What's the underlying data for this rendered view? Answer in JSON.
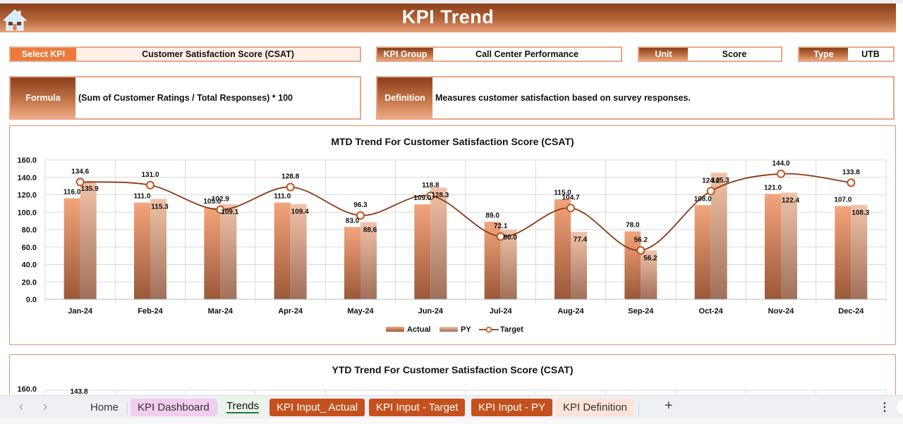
{
  "header": {
    "title": "KPI Trend",
    "home_icon": "home-icon"
  },
  "selectors": {
    "select_kpi": {
      "label": "Select KPI",
      "value": "Customer Satisfaction Score (CSAT)"
    },
    "kpi_group": {
      "label": "KPI Group",
      "value": "Call Center Performance"
    },
    "unit": {
      "label": "Unit",
      "value": "Score"
    },
    "type": {
      "label": "Type",
      "value": "UTB"
    }
  },
  "formula": {
    "label": "Formula",
    "value": "(Sum of Customer Ratings / Total Responses) * 100"
  },
  "definition": {
    "label": "Definition",
    "value": "Measures customer satisfaction based on survey responses."
  },
  "colors": {
    "actual_top": "#f3a57c",
    "actual_bottom": "#9a5838",
    "py_top": "#f1c3a8",
    "py_bottom": "#a0705a",
    "target_line": "#8b3a12",
    "marker_fill": "#ffffff",
    "marker_stroke": "#c0521a",
    "grid": "#d9d9d9"
  },
  "chart_data": [
    {
      "type": "bar",
      "title": "MTD Trend For Customer Satisfaction Score (CSAT)",
      "categories": [
        "Jan-24",
        "Feb-24",
        "Mar-24",
        "Apr-24",
        "May-24",
        "Jun-24",
        "Jul-24",
        "Aug-24",
        "Sep-24",
        "Oct-24",
        "Nov-24",
        "Dec-24"
      ],
      "series": [
        {
          "name": "Actual",
          "kind": "bar",
          "values": [
            116.0,
            111.0,
            105.0,
            111.0,
            83.0,
            109.0,
            89.0,
            115.0,
            78.0,
            108.0,
            121.0,
            107.0
          ]
        },
        {
          "name": "PY",
          "kind": "bar",
          "values": [
            135.9,
            115.3,
            109.1,
            109.4,
            88.6,
            128.3,
            80.0,
            77.4,
            56.2,
            145.3,
            122.4,
            108.3
          ]
        },
        {
          "name": "Target",
          "kind": "line",
          "values": [
            134.6,
            131.0,
            102.9,
            128.8,
            96.3,
            118.8,
            72.1,
            104.7,
            56.2,
            124.2,
            144.0,
            133.8
          ]
        }
      ],
      "yticks": [
        "0.0",
        "20.0",
        "40.0",
        "60.0",
        "80.0",
        "100.0",
        "120.0",
        "140.0",
        "160.0"
      ],
      "ylim": [
        0,
        160
      ],
      "xlabel": "",
      "ylabel": "",
      "grid": true,
      "legend": {
        "position": "bottom",
        "entries": [
          "Actual",
          "PY",
          "Target"
        ]
      }
    },
    {
      "type": "bar",
      "title": "YTD Trend For Customer Satisfaction Score (CSAT)",
      "visible_ytick": "160.0",
      "visible_labels": [
        "143.8"
      ],
      "ylim": [
        0,
        160
      ],
      "grid": true
    }
  ],
  "sheet_tabs": {
    "prev": "‹",
    "next": "›",
    "tabs": [
      {
        "label": "Home",
        "style": "home"
      },
      {
        "label": "KPI Dashboard",
        "style": "dash"
      },
      {
        "label": "Trends",
        "style": "trends",
        "active": true
      },
      {
        "label": "KPI Input_ Actual",
        "style": "input"
      },
      {
        "label": "KPI Input - Target",
        "style": "input"
      },
      {
        "label": "KPI Input - PY",
        "style": "input"
      },
      {
        "label": "KPI Definition",
        "style": "defn"
      }
    ],
    "add": "+",
    "more": "⋮"
  }
}
